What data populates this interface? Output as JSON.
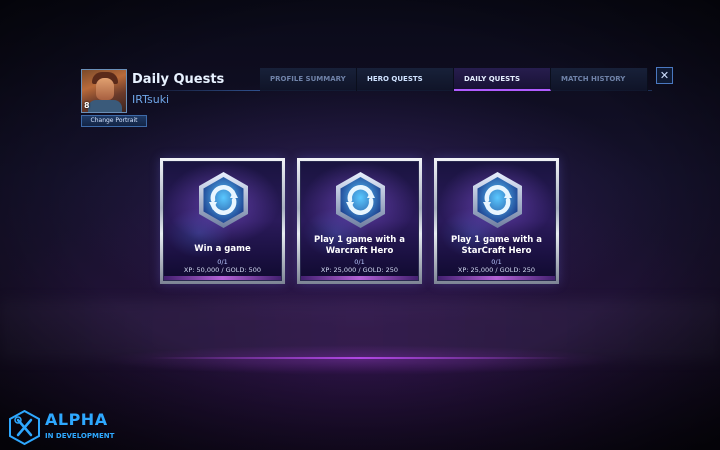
{
  "header": {
    "title": "Daily Quests",
    "player_name": "IRTsuki",
    "player_level": "8",
    "change_portrait_label": "Change Portrait"
  },
  "tabs": [
    {
      "label": "PROFILE SUMMARY",
      "active": false
    },
    {
      "label": "HERO QUESTS",
      "active": false
    },
    {
      "label": "DAILY QUESTS",
      "active": true
    },
    {
      "label": "MATCH HISTORY",
      "active": false
    }
  ],
  "close_label": "✕",
  "quests": [
    {
      "title": "Win a game",
      "progress": "0/1",
      "reward": "XP: 50,000 / GOLD: 500"
    },
    {
      "title": "Play 1 game with a Warcraft Hero",
      "progress": "0/1",
      "reward": "XP: 25,000 / GOLD: 250"
    },
    {
      "title": "Play 1 game with a StarCraft Hero",
      "progress": "0/1",
      "reward": "XP: 25,000 / GOLD: 250"
    }
  ],
  "alpha_badge": {
    "title": "ALPHA",
    "subtitle": "IN DEVELOPMENT",
    "icon": "wrench-screwdriver-icon"
  },
  "colors": {
    "accent_blue": "#2ea8ff",
    "tab_active_underline": "#b05cff",
    "title_text": "#e8f2ff",
    "player_name": "#6fa6e8"
  }
}
